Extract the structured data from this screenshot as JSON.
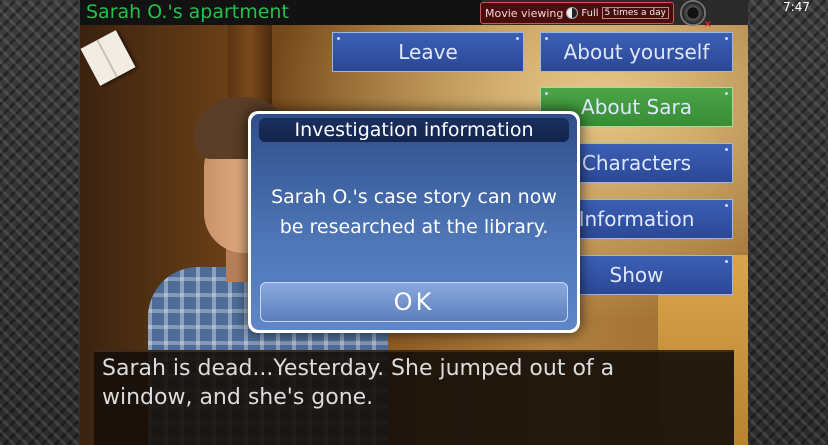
{
  "location": {
    "title": "Sarah O.'s apartment"
  },
  "hud": {
    "movie_label": "Movie viewing",
    "movie_mode": "Full",
    "movie_times": "5 times a day",
    "time": "7:47"
  },
  "menu": {
    "leave": "Leave",
    "about_yourself": "About yourself",
    "about_sara": "About Sara",
    "characters": "Characters",
    "information": "Information",
    "show": "Show"
  },
  "modal": {
    "title": "Investigation information",
    "line1": "Sarah O.'s case story can now",
    "line2": "be researched at the library.",
    "ok": "OK"
  },
  "dialogue": {
    "line1": "Sarah is dead...Yesterday. She jumped out of a",
    "line2": "window, and she's gone."
  },
  "colors": {
    "menu_blue": "#2f4f9f",
    "menu_green": "#3f9a3c",
    "location_text": "#23c24a"
  }
}
